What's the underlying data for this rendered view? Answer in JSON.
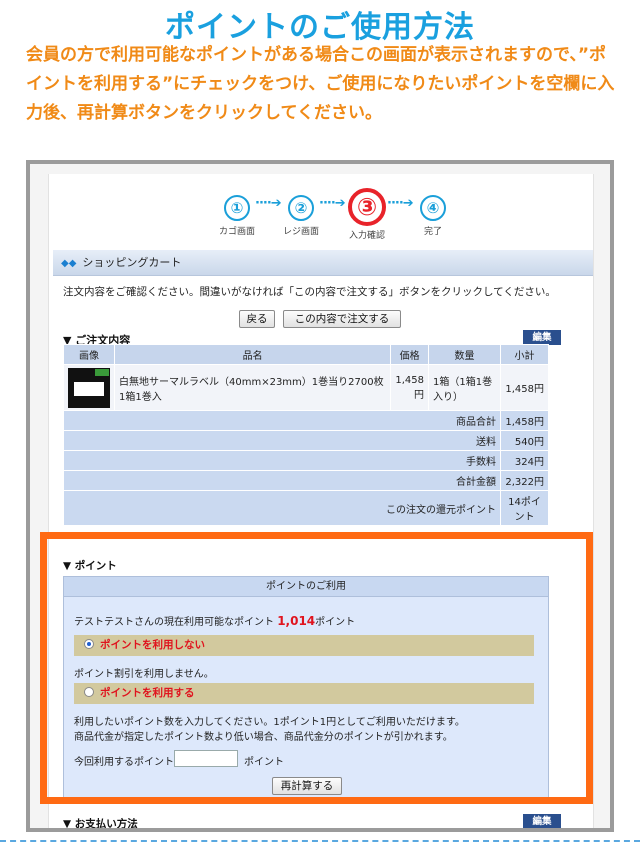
{
  "title": "ポイントのご使用方法",
  "intro": "会員の方で利用可能なポイントがある場合この画面が表示されますので、”ポイントを利用する”にチェックをつけ、ご使用になりたいポイントを空欄に入力後、再計算ボタンをクリックしてください。",
  "steps": [
    {
      "num": "①",
      "label": "カゴ画面"
    },
    {
      "num": "②",
      "label": "レジ画面"
    },
    {
      "num": "③",
      "label": "入力確認"
    },
    {
      "num": "④",
      "label": "完了"
    }
  ],
  "step_arrow": "····➔",
  "section_title": "ショッピングカート",
  "confirm_text": "注文内容をご確認ください。間違いがなければ「この内容で注文する」ボタンをクリックしてください。",
  "back_button": "戻る",
  "order_button": "この内容で注文する",
  "order_heading": "▼ ご注文内容",
  "edit_label": "編集",
  "table": {
    "headers": [
      "画像",
      "品名",
      "価格",
      "数量",
      "小計"
    ],
    "item": {
      "name": "白無地サーマルラベル（40mm×23mm）1巻当り2700枚 1箱1巻入",
      "price": "1,458円",
      "qty": "1箱（1箱1巻入り）",
      "subtotal": "1,458円"
    },
    "summary": [
      {
        "label": "商品合計",
        "value": "1,458円"
      },
      {
        "label": "送料",
        "value": "540円"
      },
      {
        "label": "手数料",
        "value": "324円"
      },
      {
        "label": "合計金額",
        "value": "2,322円"
      },
      {
        "label": "この注文の還元ポイント",
        "value": "14ポイント"
      }
    ]
  },
  "points": {
    "heading": "▼ ポイント",
    "box_title": "ポイントのご利用",
    "available_prefix": "テストテストさんの現在利用可能なポイント",
    "available_value": "1,014",
    "available_suffix": "ポイント",
    "option_no": "ポイントを利用しない",
    "option_no_desc": "ポイント割引を利用しません。",
    "option_yes": "ポイントを利用する",
    "desc1": "利用したいポイント数を入力してください。1ポイント1円としてご利用いただけます。",
    "desc2": "商品代金が指定したポイント数より低い場合、商品代金分のポイントが引かれます。",
    "input_label": "今回利用するポイント",
    "input_value": "",
    "input_unit": "ポイント",
    "recalc_button": "再計算する"
  },
  "payment_heading": "▼ お支払い方法",
  "colors": {
    "title": "#1aa0df",
    "intro": "#f08a17",
    "highlight": "#ff6a13"
  }
}
